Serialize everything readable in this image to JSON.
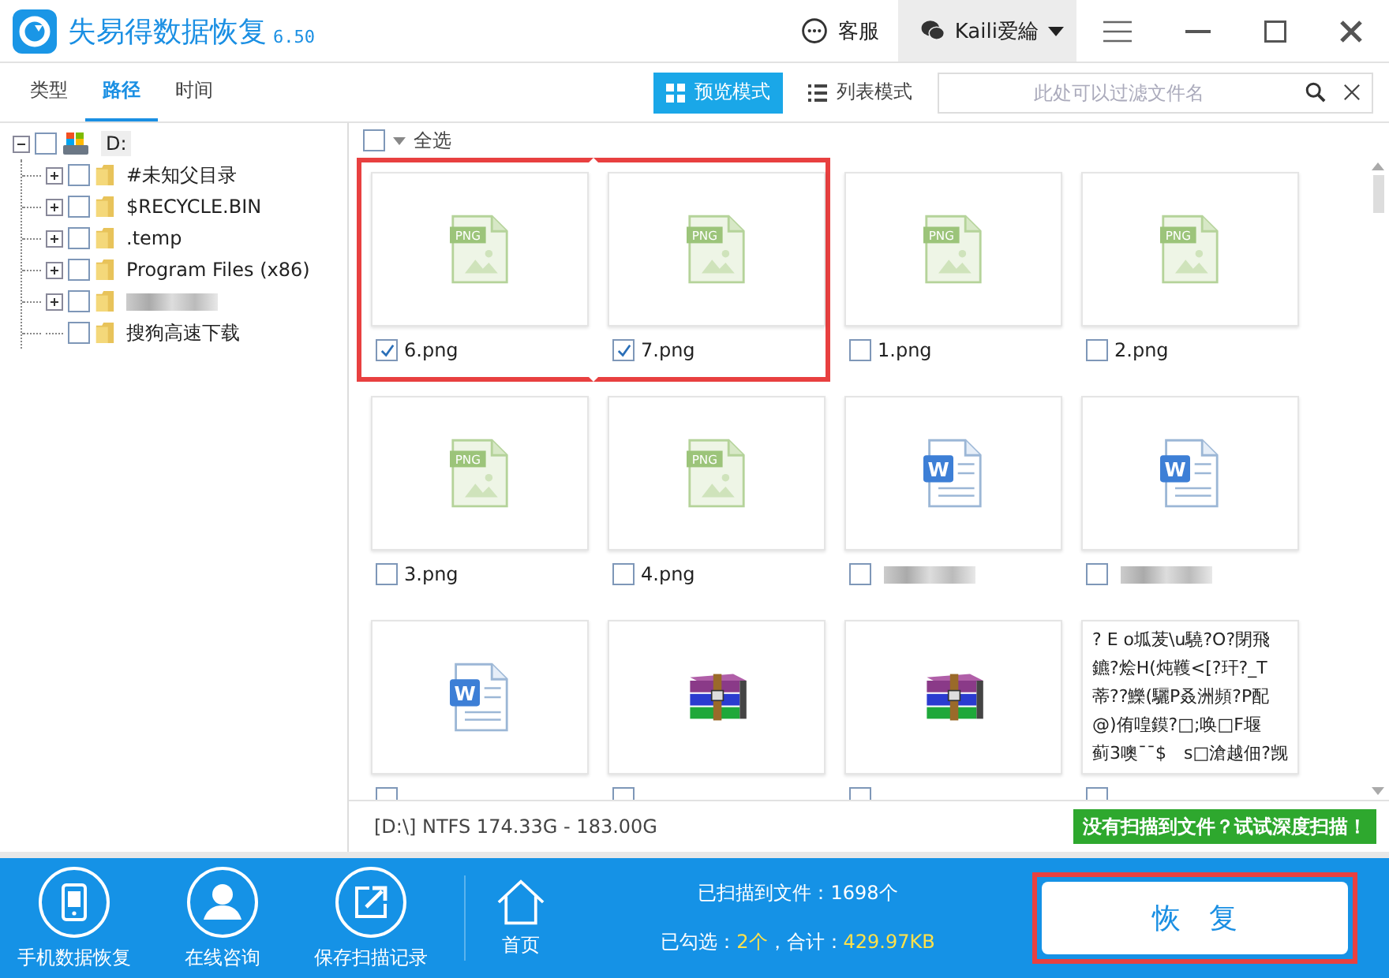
{
  "window": {
    "title": "失易得数据恢复",
    "version": "6.50",
    "support": "客服",
    "user": "Kaili爱綸"
  },
  "tabs": [
    {
      "label": "类型",
      "selected": false
    },
    {
      "label": "路径",
      "selected": true
    },
    {
      "label": "时间",
      "selected": false
    }
  ],
  "view_modes": [
    {
      "label": "预览模式",
      "selected": true,
      "kind": "grid"
    },
    {
      "label": "列表模式",
      "selected": false,
      "kind": "list"
    }
  ],
  "search": {
    "placeholder": "此处可以过滤文件名"
  },
  "tree": {
    "label": "D:",
    "checked": false,
    "expanded": true,
    "children": [
      {
        "label": "#未知父目录",
        "checked": false,
        "expandable": true
      },
      {
        "label": "$RECYCLE.BIN",
        "checked": false,
        "expandable": true
      },
      {
        "label": ".temp",
        "checked": false,
        "expandable": true
      },
      {
        "label": "Program Files (x86)",
        "checked": false,
        "expandable": true
      },
      {
        "checked": false,
        "expandable": true
      },
      {
        "label": "搜狗高速下载",
        "checked": false,
        "expandable": false
      }
    ]
  },
  "select_all": {
    "label": "全选",
    "checked": false
  },
  "files": [
    {
      "name": "6.png",
      "kind": "png",
      "icon_label": "PNG",
      "checked": true,
      "highlighted": true
    },
    {
      "name": "7.png",
      "kind": "png",
      "icon_label": "PNG",
      "checked": true,
      "highlighted": true
    },
    {
      "name": "1.png",
      "kind": "png",
      "icon_label": "PNG",
      "checked": false,
      "highlighted": false
    },
    {
      "name": "2.png",
      "kind": "png",
      "icon_label": "PNG",
      "checked": false,
      "highlighted": false
    },
    {
      "name": "3.png",
      "kind": "png",
      "icon_label": "PNG",
      "checked": false,
      "highlighted": false
    },
    {
      "name": "4.png",
      "kind": "png",
      "icon_label": "PNG",
      "checked": false,
      "highlighted": false
    },
    {
      "kind": "word",
      "icon_label": "W",
      "checked": false,
      "highlighted": false
    },
    {
      "kind": "word",
      "icon_label": "W",
      "checked": false,
      "highlighted": false
    },
    {
      "kind": "word",
      "icon_label": "W",
      "checked": false,
      "highlighted": false
    },
    {
      "kind": "rar",
      "checked": false,
      "highlighted": false
    },
    {
      "kind": "rar",
      "checked": false,
      "highlighted": false
    },
    {
      "kind": "text",
      "preview": [
        "? E o坬茇\\u驍?O?閉飛",
        "鑣?烩H(炖韄<[?玕?_T",
        "蒂??鱳(驪P叒洲頻?P配",
        "@)侑喤鏌?□;唤□F堰",
        "蓟3噢¯¯$　s□滄越佃?觊"
      ],
      "checked": false,
      "highlighted": false
    }
  ],
  "status": {
    "drive_info": "[D:\\] NTFS 174.33G - 183.00G",
    "deep_scan": "没有扫描到文件？试试深度扫描！"
  },
  "bottom_tools": [
    {
      "label": "手机数据恢复",
      "kind": "phone"
    },
    {
      "label": "在线咨询",
      "kind": "person"
    },
    {
      "label": "保存扫描记录",
      "kind": "export"
    }
  ],
  "home": {
    "label": "首页"
  },
  "summary": {
    "scanned": "已扫描到文件：1698个",
    "selected_label": "已勾选：",
    "selected_count": "2个",
    "total_label": "，合计：",
    "total": "429.97KB"
  },
  "recover_button": {
    "label": "恢　复",
    "highlighted": true
  }
}
